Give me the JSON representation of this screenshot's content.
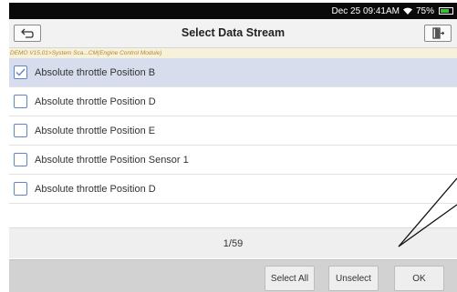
{
  "status_bar": {
    "datetime": "Dec 25 09:41AM",
    "battery_percent": "75%",
    "battery_level": 0.75,
    "icons": [
      "wifi-icon",
      "battery-icon"
    ],
    "battery_color": "#38c23a"
  },
  "header": {
    "title": "Select Data Stream",
    "back_icon": "back-arrow-icon",
    "exit_icon": "exit-icon"
  },
  "breadcrumb": {
    "text": "DEMO V15.01>System Sca...CM(Engine Control Module)"
  },
  "list": {
    "items": [
      {
        "label": "Absolute throttle Position B",
        "checked": true
      },
      {
        "label": "Absolute throttle Position D",
        "checked": false
      },
      {
        "label": "Absolute throttle Position E",
        "checked": false
      },
      {
        "label": "Absolute throttle Position Sensor 1",
        "checked": false
      },
      {
        "label": "Absolute throttle Position D",
        "checked": false
      }
    ]
  },
  "pager": {
    "text": "1/59"
  },
  "footer": {
    "select_all_label": "Select All",
    "unselect_label": "Unselect",
    "ok_label": "OK"
  },
  "colors": {
    "accent": "#5b87c9",
    "selected_row": "#d8dded",
    "breadcrumb_text": "#b58a2c",
    "breadcrumb_bg": "#f6f1db"
  }
}
